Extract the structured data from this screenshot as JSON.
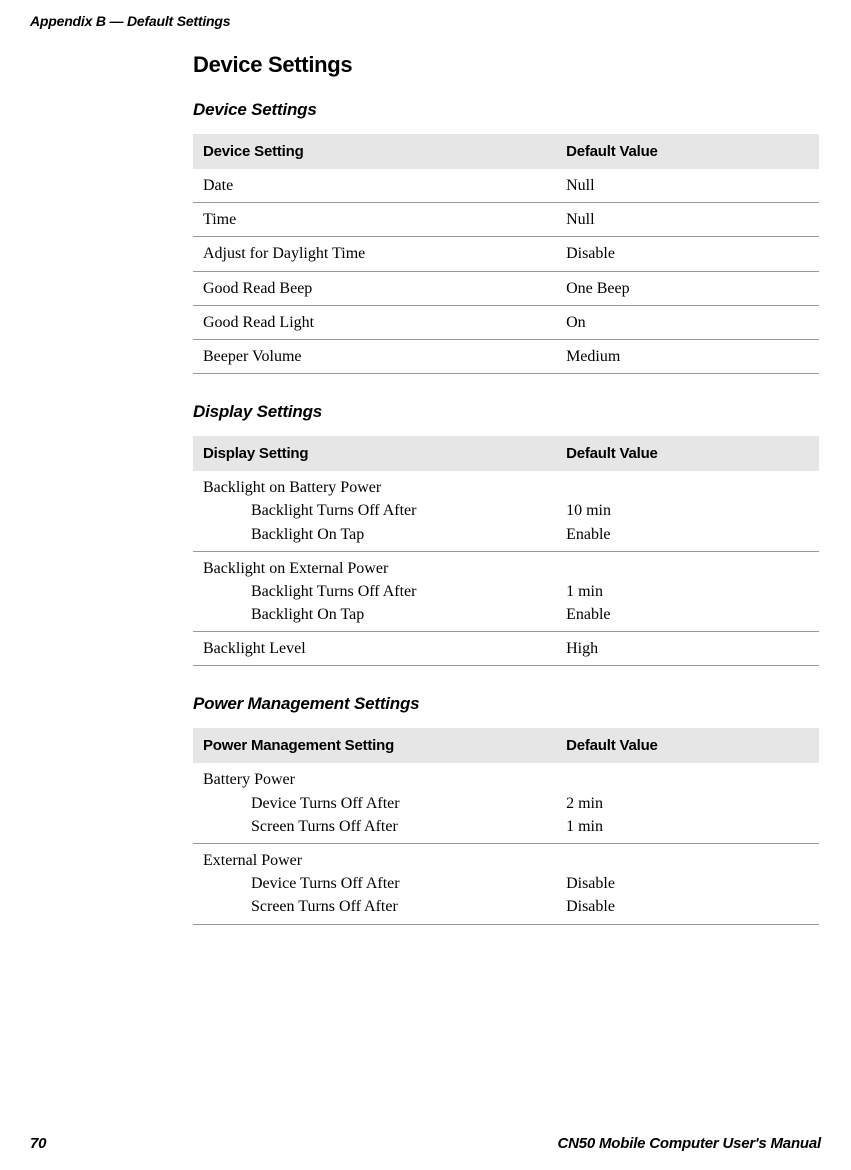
{
  "header": "Appendix B — Default Settings",
  "section_title": "Device Settings",
  "tables": [
    {
      "title": "Device Settings",
      "col1_header": "Device Setting",
      "col2_header": "Default Value",
      "rows": [
        {
          "setting": "Date",
          "value": "Null"
        },
        {
          "setting": "Time",
          "value": "Null"
        },
        {
          "setting": "Adjust for Daylight Time",
          "value": "Disable"
        },
        {
          "setting": "Good Read Beep",
          "value": "One Beep"
        },
        {
          "setting": "Good Read Light",
          "value": "On"
        },
        {
          "setting": "Beeper Volume",
          "value": "Medium"
        }
      ]
    },
    {
      "title": "Display Settings",
      "col1_header": "Display Setting",
      "col2_header": "Default Value",
      "rows": [
        {
          "setting": "Backlight on Battery Power",
          "sub": [
            {
              "label": "Backlight Turns Off After",
              "value": "10 min"
            },
            {
              "label": "Backlight On Tap",
              "value": "Enable"
            }
          ]
        },
        {
          "setting": "Backlight on External Power",
          "sub": [
            {
              "label": "Backlight Turns Off After",
              "value": "1 min"
            },
            {
              "label": "Backlight On Tap",
              "value": "Enable"
            }
          ]
        },
        {
          "setting": "Backlight Level",
          "value": "High"
        }
      ]
    },
    {
      "title": "Power Management Settings",
      "col1_header": "Power Management Setting",
      "col2_header": "Default Value",
      "rows": [
        {
          "setting": "Battery Power",
          "sub": [
            {
              "label": "Device Turns Off After",
              "value": "2 min"
            },
            {
              "label": "Screen Turns Off After",
              "value": "1 min"
            }
          ]
        },
        {
          "setting": "External Power",
          "sub": [
            {
              "label": "Device Turns Off After",
              "value": "Disable"
            },
            {
              "label": "Screen Turns Off After",
              "value": "Disable"
            }
          ]
        }
      ]
    }
  ],
  "footer": {
    "page": "70",
    "manual": "CN50 Mobile Computer User's Manual"
  }
}
